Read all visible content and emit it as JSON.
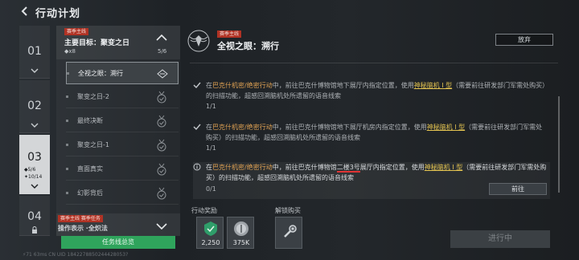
{
  "header": {
    "title": "行动计划"
  },
  "chapters": [
    {
      "number": "01"
    },
    {
      "number": "02"
    },
    {
      "number": "03",
      "sub1": "◆5/6",
      "sub2": "✦10/14"
    },
    {
      "number": "04"
    }
  ],
  "quest_list": {
    "tag": "赛季主线",
    "main_title": "主要目标：聚变之日",
    "x8": "◆x8",
    "count": "5/6",
    "items": [
      {
        "label": "全视之眼：溯行"
      },
      {
        "label": "聚变之日-2"
      },
      {
        "label": "最终决断"
      },
      {
        "label": "聚变之日-1"
      },
      {
        "label": "直面真实"
      },
      {
        "label": "幻影背后"
      }
    ],
    "next_tag": "赛季主线 赛季任务",
    "next_title": "操作表示 ·全炽法",
    "overview_button": "任务线总览"
  },
  "detail": {
    "tag": "赛季主线",
    "title": "全视之眼：溯行",
    "abandon_button": "放弃",
    "tasks": [
      {
        "pre": "在",
        "hl": "巴克什机密/绝密行动",
        "mid": "中，前往巴克什博物馆地下展厅内指定位置，使用",
        "link": "神秘脑机 I 型",
        "post": "（需要前往研发部门军需处购买）的扫描功能，超感回溯脑机处所遗留的语音线索",
        "progress": "1/1"
      },
      {
        "pre": "在",
        "hl": "巴克什机密/绝密行动",
        "mid": "中，前往巴克什博物馆地下展厅机房内指定位置，使用",
        "link": "神秘脑机 I 型",
        "post": "（需要前往研发部门军需处购买）的扫描功能，超感回溯脑机处所遗留的语音线索",
        "progress": "1/1"
      },
      {
        "pre": "在",
        "hl": "巴克什机密/绝密行动",
        "mid": "中，前往巴克什博物馆",
        "red": "二楼3号",
        "mid2": "展厅内指定位置，使用",
        "link": "神秘脑机 I 型",
        "post": "（需要前往研发部门军需处购买）的扫描功能，超感回溯脑机处所遗留的语音线索",
        "progress": "0/1"
      }
    ],
    "goto_button": "前往"
  },
  "rewards": {
    "label": "行动奖励",
    "items": [
      {
        "amount": "2,250"
      },
      {
        "amount": "375K"
      }
    ],
    "unlock_label": "解锁购买",
    "progress_button": "进行中"
  },
  "footer": {
    "text": "⚡71  63ms    CN UID 1842278850244428053?"
  },
  "colors": {
    "accent_green": "#2fa45c",
    "tag_red": "#b03224",
    "highlight": "#e0a253",
    "link": "#e4c451"
  }
}
